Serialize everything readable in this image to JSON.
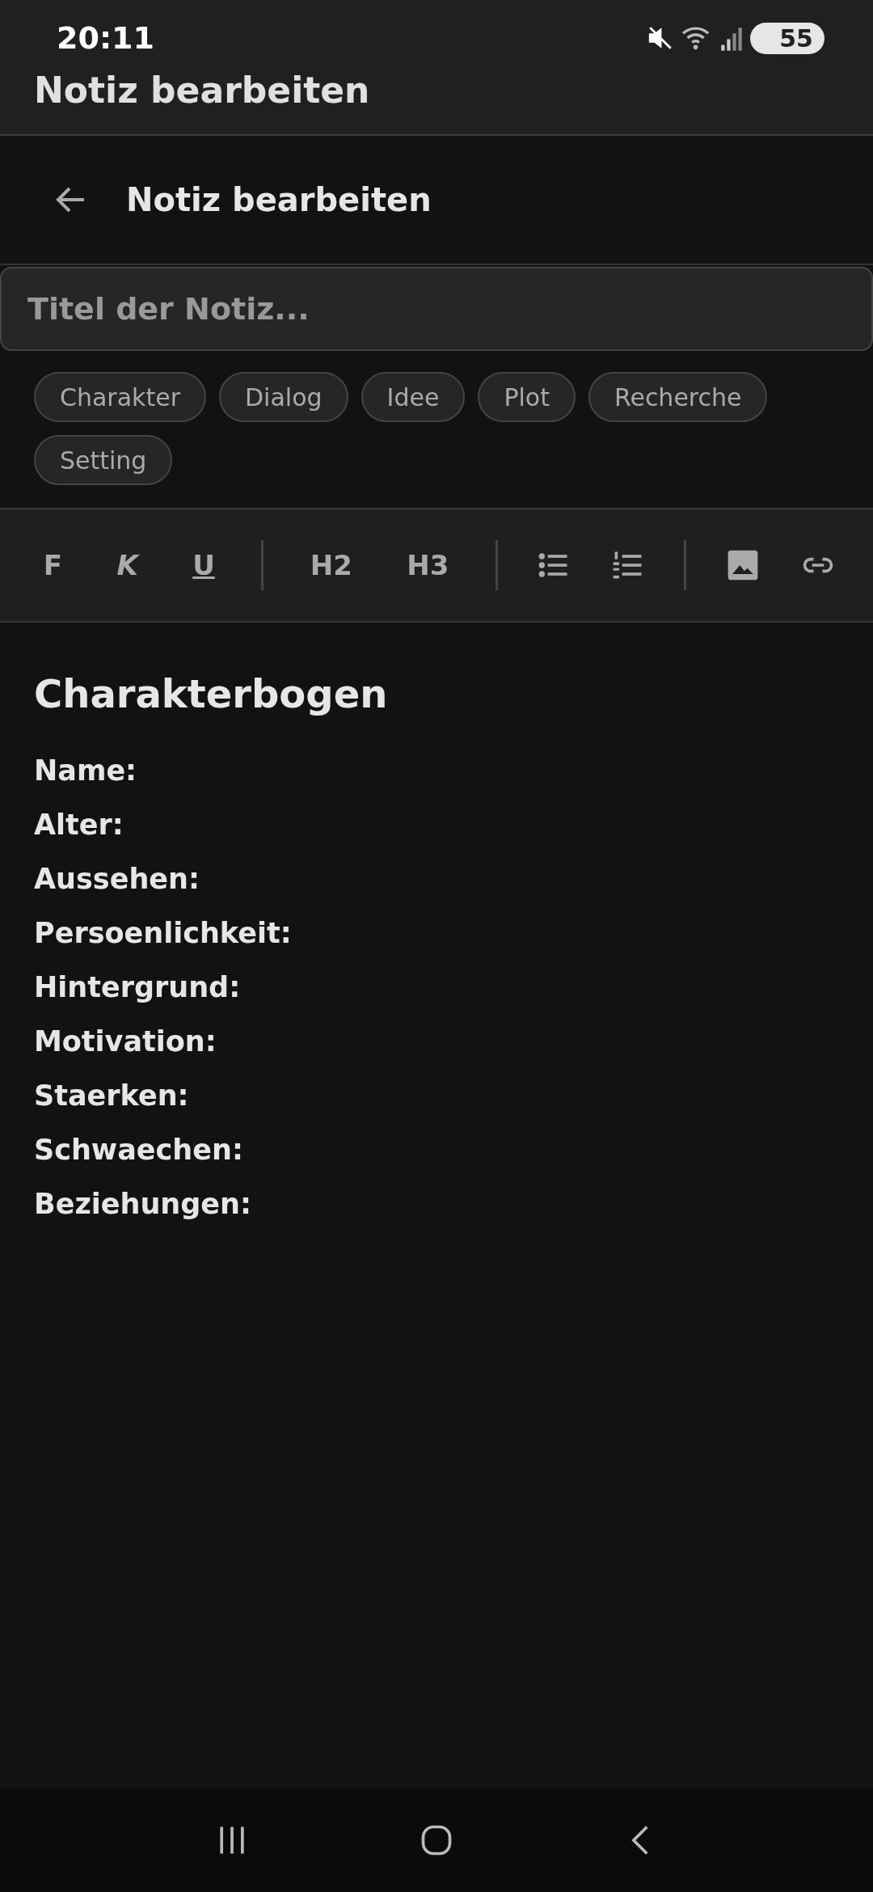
{
  "status_bar": {
    "time": "20:11",
    "battery": "55"
  },
  "app_title": "Notiz bearbeiten",
  "header": {
    "title": "Notiz bearbeiten"
  },
  "title_field": {
    "placeholder": "Titel der Notiz..."
  },
  "tags": [
    "Charakter",
    "Dialog",
    "Idee",
    "Plot",
    "Recherche",
    "Setting"
  ],
  "toolbar": [
    {
      "kind": "bold",
      "label": "F"
    },
    {
      "kind": "italic",
      "label": "K"
    },
    {
      "kind": "underline",
      "label": "U"
    },
    {
      "kind": "separator"
    },
    {
      "kind": "text",
      "label": "H2"
    },
    {
      "kind": "text",
      "label": "H3"
    },
    {
      "kind": "separator"
    },
    {
      "kind": "bullets"
    },
    {
      "kind": "numbers"
    },
    {
      "kind": "separator"
    },
    {
      "kind": "image"
    },
    {
      "kind": "link"
    }
  ],
  "content": {
    "heading": "Charakterbogen",
    "lines": [
      "Name:",
      "Alter:",
      "Aussehen:",
      "Persoenlichkeit:",
      "Hintergrund:",
      "Motivation:",
      "Staerken:",
      "Schwaechen:",
      "Beziehungen:"
    ]
  }
}
